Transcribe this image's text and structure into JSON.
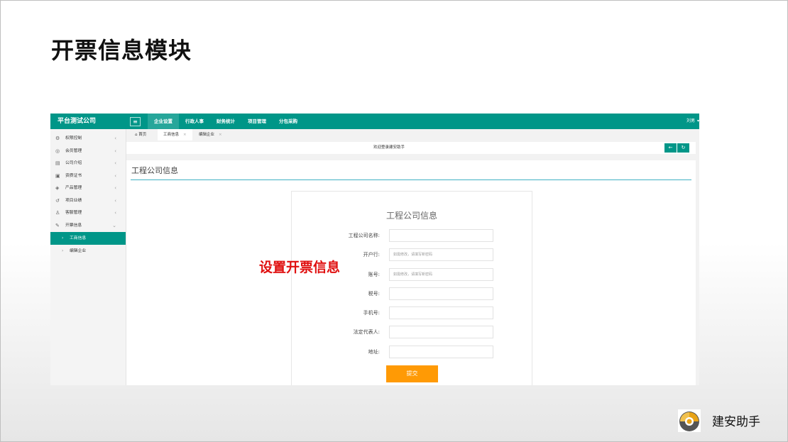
{
  "slide": {
    "title": "开票信息模块",
    "annotation": "设置开票信息",
    "logo_text": "建安助手",
    "accent_color": "#009688"
  },
  "app": {
    "brand": "平台测试公司",
    "menu_icon": "hamburger-icon",
    "nav": [
      "企业设置",
      "行政人事",
      "财务统计",
      "项目管理",
      "分包采购"
    ],
    "nav_active": "企业设置",
    "user": "刘男",
    "sidebar": [
      {
        "label": "权限控制",
        "icon": "gear-icon"
      },
      {
        "label": "会员管理",
        "icon": "user-circle-icon"
      },
      {
        "label": "公司介绍",
        "icon": "document-icon"
      },
      {
        "label": "资质证书",
        "icon": "image-icon"
      },
      {
        "label": "产品管理",
        "icon": "cube-icon"
      },
      {
        "label": "项目业绩",
        "icon": "history-icon"
      },
      {
        "label": "客服管理",
        "icon": "person-icon"
      },
      {
        "label": "开票信息",
        "icon": "edit-icon",
        "expanded": true
      }
    ],
    "sidebar_sub": [
      {
        "label": "工商信息",
        "active": true
      },
      {
        "label": "编辑企业",
        "active": false
      }
    ],
    "tabs": [
      {
        "label": "首页",
        "icon": "home-icon",
        "closable": false
      },
      {
        "label": "工商信息",
        "closable": true,
        "active": true
      },
      {
        "label": "编辑企业",
        "closable": true
      }
    ],
    "welcome": "欢迎登录建安助手",
    "toolbar_icons": [
      "back-arrow-icon",
      "refresh-icon"
    ],
    "section_title": "工程公司信息",
    "form": {
      "title": "工程公司信息",
      "fields": [
        {
          "label": "工程公司名称:",
          "placeholder": ""
        },
        {
          "label": "开户行:",
          "placeholder": "如需修改，请填写新密码"
        },
        {
          "label": "账号:",
          "placeholder": "如需修改，请填写新密码"
        },
        {
          "label": "税号:",
          "placeholder": ""
        },
        {
          "label": "手机号:",
          "placeholder": ""
        },
        {
          "label": "法定代表人:",
          "placeholder": ""
        },
        {
          "label": "地址:",
          "placeholder": ""
        }
      ],
      "submit": "提交"
    }
  }
}
